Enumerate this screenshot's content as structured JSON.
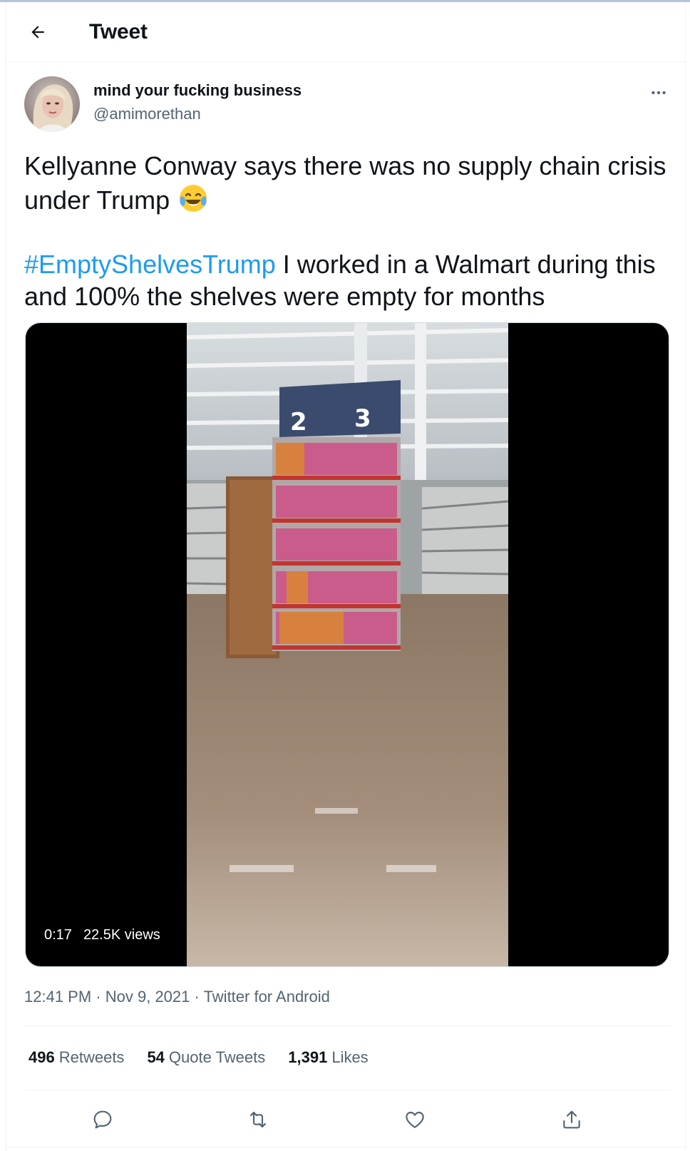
{
  "header": {
    "title": "Tweet",
    "back_icon": "arrow-left-icon"
  },
  "author": {
    "display_name": "mind your fucking business",
    "handle": "@amimorethan",
    "more_icon": "more-horizontal-icon"
  },
  "tweet": {
    "line1": "Kellyanne Conway says there was no supply chain crisis under Trump",
    "emoji": "face-with-tears-of-joy",
    "hashtag": "#EmptyShelvesTrump",
    "line2": " I worked in a Walmart during this and 100% the shelves were empty for months"
  },
  "video": {
    "duration": "0:17",
    "views": "22.5K views"
  },
  "meta": {
    "time": "12:41 PM",
    "separator": "·",
    "date": "Nov 9, 2021",
    "source": "Twitter for Android"
  },
  "stats": {
    "retweets_count": "496",
    "retweets_label": "Retweets",
    "quotes_count": "54",
    "quotes_label": "Quote Tweets",
    "likes_count": "1,391",
    "likes_label": "Likes"
  },
  "actions": [
    {
      "icon": "reply-icon"
    },
    {
      "icon": "retweet-icon"
    },
    {
      "icon": "heart-icon"
    },
    {
      "icon": "share-icon"
    }
  ],
  "colors": {
    "link": "#1d9bf0",
    "secondary_text": "#536471",
    "primary_text": "#0f1419"
  }
}
